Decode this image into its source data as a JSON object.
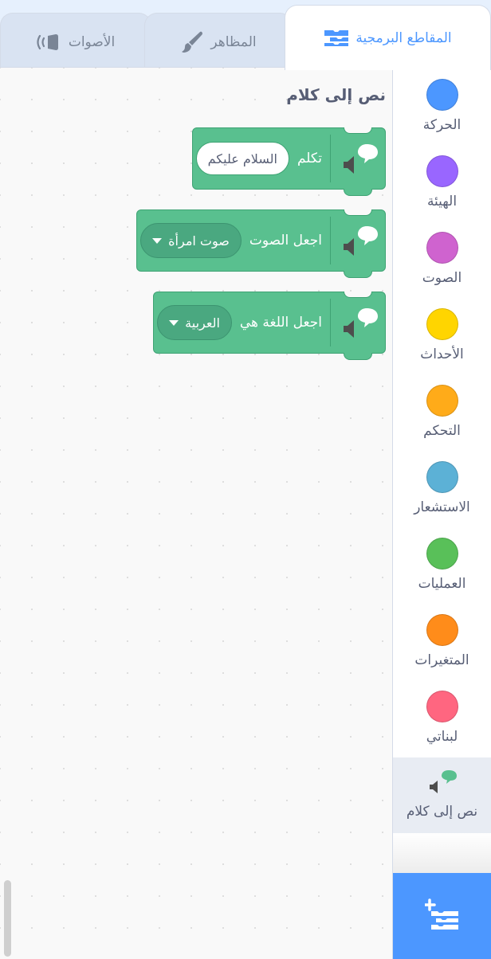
{
  "tabs": [
    {
      "label": "المقاطع البرمجية",
      "icon": "code-blocks-icon",
      "active": true
    },
    {
      "label": "المظاهر",
      "icon": "paintbrush-icon",
      "active": false
    },
    {
      "label": "الأصوات",
      "icon": "speaker-icon",
      "active": false
    }
  ],
  "workspace": {
    "heading": "نص إلى كلام",
    "blocks": {
      "speak": {
        "label": "تكلم",
        "value": "السلام عليكم"
      },
      "voice": {
        "label": "اجعل الصوت",
        "value": "صوت امرأة"
      },
      "language": {
        "label": "اجعل اللغة هي",
        "value": "العربية"
      }
    }
  },
  "categories": [
    {
      "label": "الحركة",
      "color": "#4c97ff"
    },
    {
      "label": "الهيئة",
      "color": "#9966ff"
    },
    {
      "label": "الصوت",
      "color": "#cf63cf"
    },
    {
      "label": "الأحداث",
      "color": "#ffd500"
    },
    {
      "label": "التحكم",
      "color": "#ffab19"
    },
    {
      "label": "الاستشعار",
      "color": "#5cb1d6"
    },
    {
      "label": "العمليات",
      "color": "#59c059"
    },
    {
      "label": "المتغيرات",
      "color": "#ff8c1a"
    },
    {
      "label": "لبناتي",
      "color": "#ff6680"
    },
    {
      "label": "نص إلى كلام",
      "icon": "text-to-speech-icon",
      "selected": true
    }
  ],
  "colors": {
    "accent": "#4c97ff",
    "extension_block": "#59c08f",
    "extension_border": "#3fa374"
  },
  "add_extension_icon": "add-extension-icon"
}
